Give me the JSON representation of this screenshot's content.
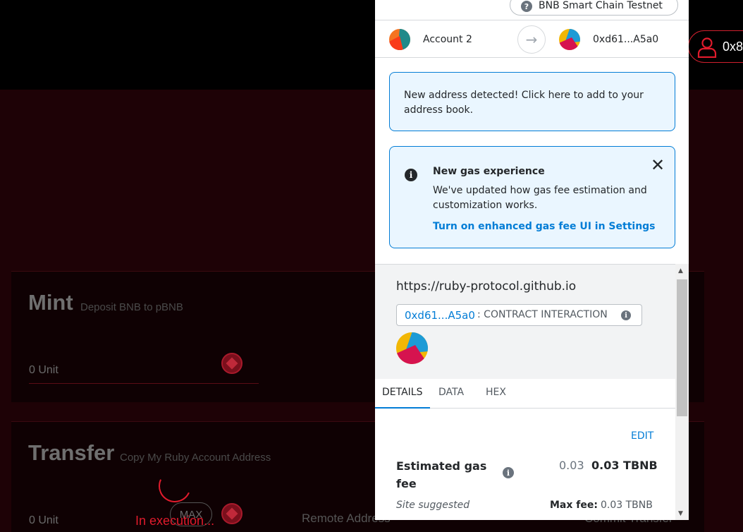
{
  "dapp": {
    "account_short": "0x8",
    "mint": {
      "title": "Mint",
      "subtitle": "Deposit BNB to pBNB",
      "amount_placeholder": "0 Unit"
    },
    "transfer": {
      "title": "Transfer",
      "subtitle": "Copy My Ruby Account Address",
      "amount_placeholder": "0 Unit",
      "max_label": "MAX",
      "status": "In execution...",
      "remote_address_placeholder": "Remote Address",
      "commit_label": "Commit Transfer"
    }
  },
  "metamask": {
    "network": "BNB Smart Chain Testnet",
    "from_account": "Account 2",
    "to_account": "0xd61...A5a0",
    "address_alert": "New address detected! Click here to add to your address book.",
    "gas_alert": {
      "title": "New gas experience",
      "body": "We've updated how gas fee estimation and customization works.",
      "link": "Turn on enhanced gas fee UI in Settings"
    },
    "origin": "https://ruby-protocol.github.io",
    "contract_address": "0xd61...A5a0",
    "contract_type": ": CONTRACT INTERACTION",
    "tabs": [
      "DETAILS",
      "DATA",
      "HEX"
    ],
    "edit_label": "EDIT",
    "estimated_gas_label": "Estimated gas fee",
    "gas_fee_muted": "0.03",
    "gas_fee_bold": "0.03 TBNB",
    "site_suggested": "Site suggested",
    "max_fee_label": "Max fee:",
    "max_fee_value": "0.03 TBNB"
  },
  "colors": {
    "accent_red": "#e01b2c",
    "metamask_blue": "#037dd6",
    "alert_bg": "#eaf6ff"
  }
}
